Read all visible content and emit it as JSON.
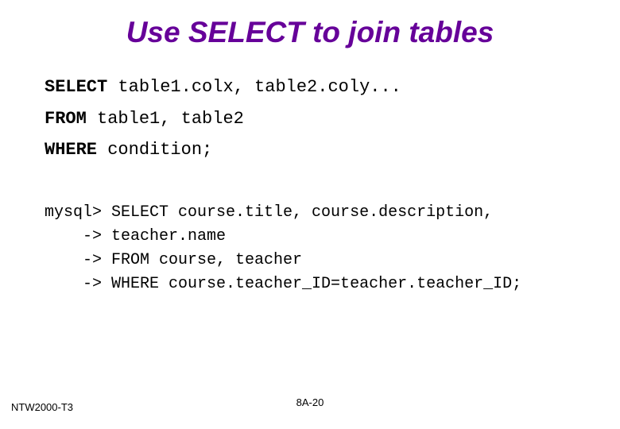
{
  "title": "Use SELECT to join tables",
  "syntax": {
    "line1_kw": "SELECT",
    "line1_rest": " table1.colx, table2.coly...",
    "line2_kw": "FROM",
    "line2_rest": " table1, table2",
    "line3_kw": "WHERE",
    "line3_rest": " condition;"
  },
  "example": {
    "l1": "mysql> SELECT course.title, course.description,",
    "l2": "    -> teacher.name",
    "l3": "    -> FROM course, teacher",
    "l4": "    -> WHERE course.teacher_ID=teacher.teacher_ID;"
  },
  "footer": {
    "left": "NTW2000-T3",
    "center": "8A-20"
  }
}
